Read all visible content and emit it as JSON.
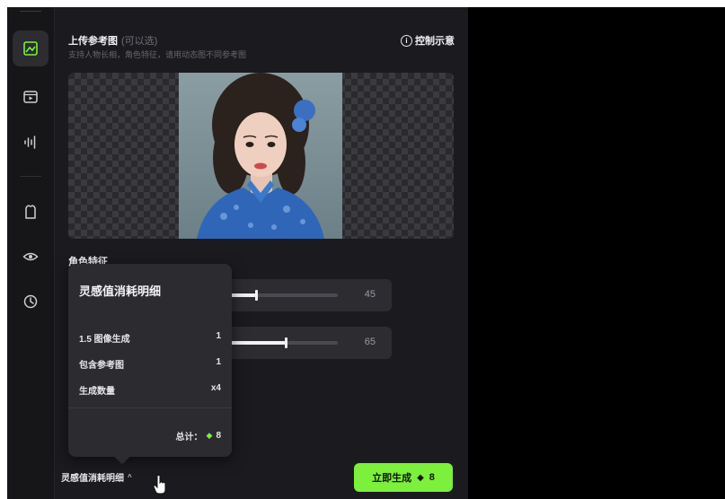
{
  "upload": {
    "title": "上传参考图",
    "optional": "(可以选)",
    "subtitle": "支持人物长相，角色特征，请用动态图不同参考图",
    "example": "控制示意",
    "info_icon": "info-circle-icon"
  },
  "features": {
    "label": "角色特征",
    "sliders": [
      {
        "value_label": "45",
        "value": 0.45
      },
      {
        "value_label": "65",
        "value": 0.65
      }
    ]
  },
  "cost_popover": {
    "title": "灵感值消耗明细",
    "rows": [
      {
        "label": "1.5 图像生成",
        "value": "1"
      },
      {
        "label": "包含参考图",
        "value": "1"
      },
      {
        "label": "生成数量",
        "value": "x4"
      }
    ],
    "total_label": "总计：",
    "total_icon": "gem-icon",
    "total_value": "8"
  },
  "footer": {
    "cost_link": "灵感值消耗明细",
    "chevron": "^"
  },
  "generate": {
    "label": "立即生成",
    "cost": "8",
    "accent": "#7cf03a"
  },
  "rail": {
    "icons": [
      "image-gen-icon",
      "video-icon",
      "audio-wave-icon",
      "shirt-icon",
      "eye-icon",
      "clock-icon"
    ]
  }
}
